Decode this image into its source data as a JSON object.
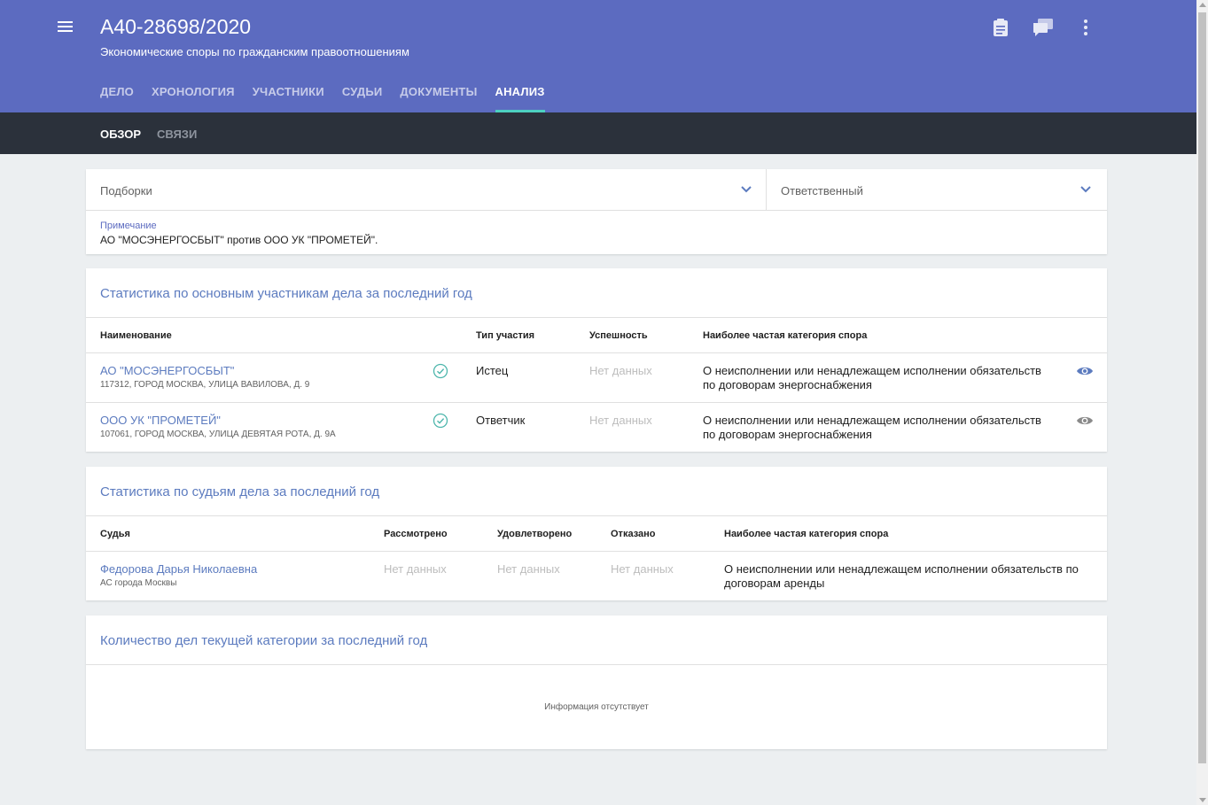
{
  "header": {
    "case_number": "А40-28698/2020",
    "subtitle": "Экономические споры по гражданским правоотношениям",
    "tabs": [
      "ДЕЛО",
      "ХРОНОЛОГИЯ",
      "УЧАСТНИКИ",
      "СУДЬИ",
      "ДОКУМЕНТЫ",
      "АНАЛИЗ"
    ],
    "active_tab": "АНАЛИЗ",
    "icons": [
      "clipboard-icon",
      "comments-icon",
      "more-vert-icon"
    ]
  },
  "subnav": {
    "tabs": [
      "ОБЗОР",
      "СВЯЗИ"
    ],
    "active_tab": "ОБЗОР"
  },
  "filters": {
    "collections_label": "Подборки",
    "responsible_label": "Ответственный",
    "note_label": "Примечание",
    "note_value": "АО \"МОСЭНЕРГОСБЫТ\" против ООО УК \"ПРОМЕТЕЙ\"."
  },
  "participants": {
    "title": "Статистика по основным участникам дела за последний год",
    "headers": [
      "Наименование",
      "Тип участия",
      "Успешность",
      "Наиболее частая категория спора"
    ],
    "rows": [
      {
        "name": "АО \"МОСЭНЕРГОСБЫТ\"",
        "address": "117312, ГОРОД МОСКВА, УЛИЦА ВАВИЛОВА, Д. 9",
        "role": "Истец",
        "success": "Нет данных",
        "category_line1": "О неисполнении или ненадлежащем исполнении обязательств",
        "category_line2": "по договорам энергоснабжения",
        "watched": true
      },
      {
        "name": "ООО УК \"ПРОМЕТЕЙ\"",
        "address": "107061, ГОРОД МОСКВА, УЛИЦА ДЕВЯТАЯ РОТА, Д. 9А",
        "role": "Ответчик",
        "success": "Нет данных",
        "category_line1": "О неисполнении или ненадлежащем исполнении обязательств",
        "category_line2": "по договорам энергоснабжения",
        "watched": false
      }
    ]
  },
  "judges": {
    "title": "Статистика по судьям дела за последний год",
    "headers": [
      "Судья",
      "Рассмотрено",
      "Удовлетворено",
      "Отказано",
      "Наиболее частая категория спора"
    ],
    "rows": [
      {
        "name": "Федорова Дарья Николаевна",
        "court": "АС города Москвы",
        "considered": "Нет данных",
        "satisfied": "Нет данных",
        "refused": "Нет данных",
        "category_line1": "О неисполнении или ненадлежащем исполнении обязательств по",
        "category_line2": "договорам аренды"
      }
    ]
  },
  "category_count": {
    "title": "Количество дел текущей категории за последний год",
    "empty_text": "Информация отсутствует"
  },
  "colors": {
    "appbar": "#5c6bc0",
    "subbar": "#2b313b",
    "tab_indicator": "#4dd0c1",
    "link": "#5c7bbf",
    "check": "#4db6ac"
  }
}
